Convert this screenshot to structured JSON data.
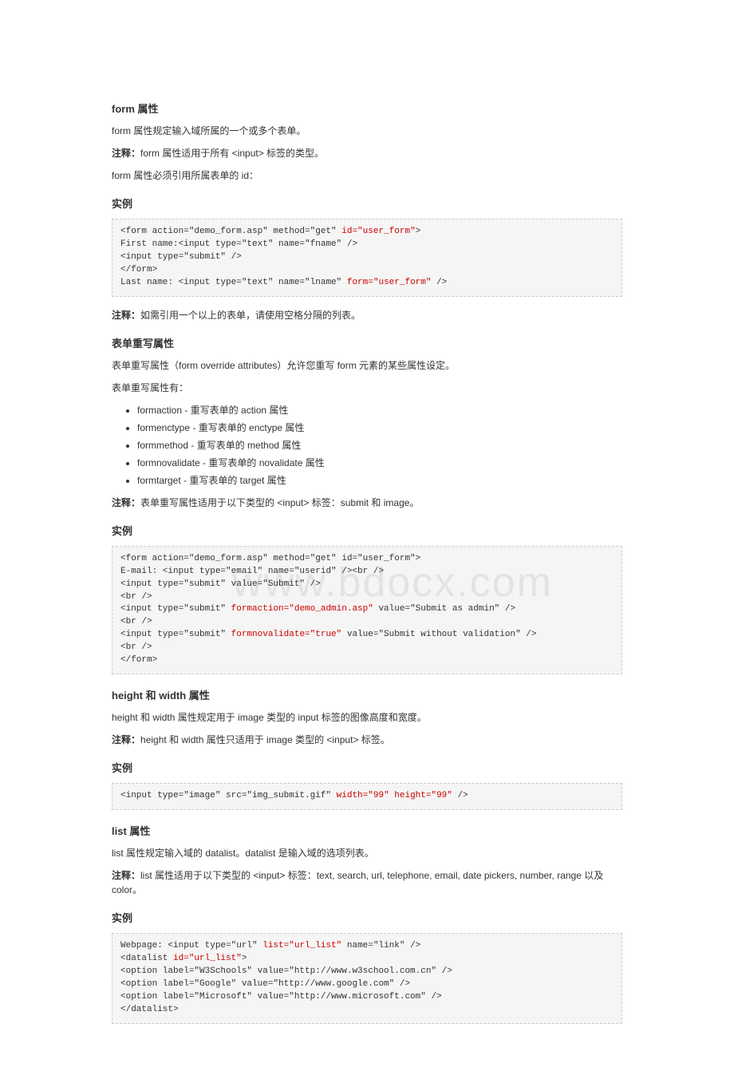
{
  "watermark": "www.bdocx.com",
  "s1": {
    "heading": "form 属性",
    "p1": "form 属性规定输入域所属的一个或多个表单。",
    "p2a": "注释：",
    "p2b": "form 属性适用于所有 <input> 标签的类型。",
    "p3": "form 属性必须引用所属表单的 id：",
    "example_label": "实例",
    "code_plain1": "<form action=\"demo_form.asp\" method=\"get\" ",
    "code_hl1": "id=\"user_form\"",
    "code_plain1b": ">",
    "code_l2": "First name:<input type=\"text\" name=\"fname\" />",
    "code_l3": "<input type=\"submit\" />",
    "code_l4": "</form>",
    "code_l5a": "Last name: <input type=\"text\" name=\"lname\" ",
    "code_l5hl": "form=\"user_form\"",
    "code_l5b": " />",
    "note2a": "注释：",
    "note2b": "如需引用一个以上的表单，请使用空格分隔的列表。"
  },
  "s2": {
    "heading": "表单重写属性",
    "p1": "表单重写属性（form override attributes）允许您重写 form 元素的某些属性设定。",
    "p2": "表单重写属性有：",
    "items": [
      "formaction - 重写表单的 action 属性",
      "formenctype - 重写表单的 enctype 属性",
      "formmethod - 重写表单的 method 属性",
      "formnovalidate - 重写表单的 novalidate 属性",
      "formtarget - 重写表单的 target 属性"
    ],
    "note_a": "注释：",
    "note_b": "表单重写属性适用于以下类型的 <input> 标签：submit 和 image。",
    "example_label": "实例",
    "c_l1": "<form action=\"demo_form.asp\" method=\"get\" id=\"user_form\">",
    "c_l2": "E-mail: <input type=\"email\" name=\"userid\" /><br />",
    "c_l3": "<input type=\"submit\" value=\"Submit\" />",
    "c_l4": "<br />",
    "c_l5a": "<input type=\"submit\" ",
    "c_l5hl": "formaction=\"demo_admin.asp\"",
    "c_l5b": " value=\"Submit as admin\" />",
    "c_l6": "<br />",
    "c_l7a": "<input type=\"submit\" ",
    "c_l7hl": "formnovalidate=\"true\"",
    "c_l7b": " value=\"Submit without validation\" />",
    "c_l8": "<br />",
    "c_l9": "</form>"
  },
  "s3": {
    "heading": "height 和 width 属性",
    "p1": "height 和 width 属性规定用于 image 类型的 input 标签的图像高度和宽度。",
    "p2a": "注释：",
    "p2b": "height 和 width 属性只适用于 image 类型的 <input> 标签。",
    "example_label": "实例",
    "c_a": "<input type=\"image\" src=\"img_submit.gif\" ",
    "c_hl": "width=\"99\" height=\"99\"",
    "c_b": " />"
  },
  "s4": {
    "heading": "list 属性",
    "p1": "list 属性规定输入域的 datalist。datalist 是输入域的选项列表。",
    "p2a": "注释：",
    "p2b": "list 属性适用于以下类型的 <input> 标签：text, search, url, telephone, email, date pickers, number, range 以及 color。",
    "example_label": "实例",
    "c_l1a": "Webpage: <input type=\"url\" ",
    "c_l1hl": "list=\"url_list\"",
    "c_l1b": " name=\"link\" />",
    "c_l2a": "<datalist ",
    "c_l2hl": "id=\"url_list\"",
    "c_l2b": ">",
    "c_l3": "<option label=\"W3Schools\" value=\"http://www.w3school.com.cn\" />",
    "c_l4": "<option label=\"Google\" value=\"http://www.google.com\" />",
    "c_l5": "<option label=\"Microsoft\" value=\"http://www.microsoft.com\" />",
    "c_l6": "</datalist>"
  }
}
